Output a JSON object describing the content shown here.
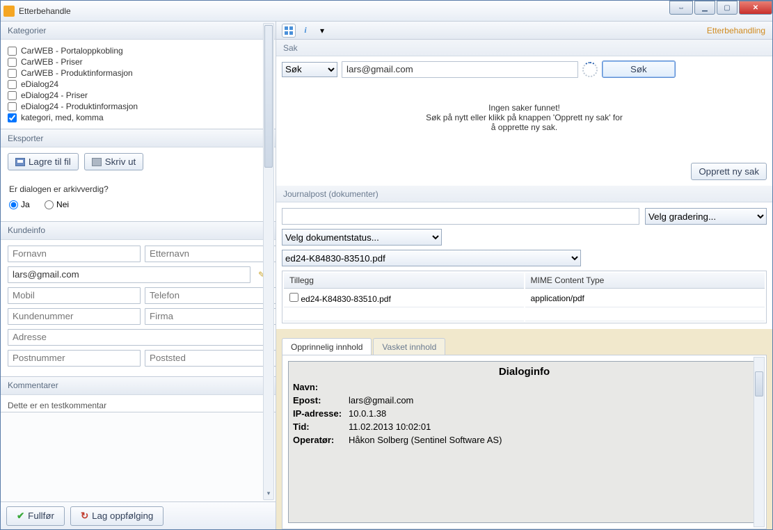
{
  "window": {
    "title": "Etterbehandle"
  },
  "right_header": {
    "title": "Etterbehandling"
  },
  "left": {
    "kategorier_title": "Kategorier",
    "kategori_items": [
      {
        "label": "CarWEB - Portaloppkobling",
        "checked": false
      },
      {
        "label": "CarWEB - Priser",
        "checked": false
      },
      {
        "label": "CarWEB - Produktinformasjon",
        "checked": false
      },
      {
        "label": "eDialog24",
        "checked": false
      },
      {
        "label": "eDialog24 - Priser",
        "checked": false
      },
      {
        "label": "eDialog24 - Produktinformasjon",
        "checked": false
      },
      {
        "label": "kategori, med, komma",
        "checked": true
      }
    ],
    "eksporter_title": "Eksporter",
    "lagre_btn": "Lagre til fil",
    "skrivut_btn": "Skriv ut",
    "arkiv_q": "Er dialogen er arkivverdig?",
    "arkiv_ja": "Ja",
    "arkiv_nei": "Nei",
    "kundeinfo_title": "Kundeinfo",
    "kunde": {
      "fornavn_ph": "Fornavn",
      "etternavn_ph": "Etternavn",
      "email": "lars@gmail.com",
      "mobil_ph": "Mobil",
      "telefon_ph": "Telefon",
      "kundenr_ph": "Kundenummer",
      "firma_ph": "Firma",
      "adresse_ph": "Adresse",
      "postnr_ph": "Postnummer",
      "poststed_ph": "Poststed"
    },
    "kommentarer_title": "Kommentarer",
    "kommentar_text": "Dette er en testkommentar"
  },
  "footer": {
    "fullfor": "Fullfør",
    "lagopp": "Lag oppfølging"
  },
  "sak": {
    "section_title": "Sak",
    "dropdown": "Søk",
    "search_value": "lars@gmail.com",
    "sok_btn": "Søk",
    "msg_l1": "Ingen saker funnet!",
    "msg_l2": "Søk på nytt  eller klikk på knappen 'Opprett ny sak' for",
    "msg_l3": "å opprette ny sak.",
    "opprett_btn": "Opprett ny sak"
  },
  "journal": {
    "section_title": "Journalpost (dokumenter)",
    "gradering": "Velg gradering...",
    "dokstatus": "Velg dokumentstatus...",
    "file_sel": "ed24-K84830-83510.pdf",
    "col_tillegg": "Tillegg",
    "col_mime": "MIME Content Type",
    "row_file": "ed24-K84830-83510.pdf",
    "row_mime": "application/pdf"
  },
  "tabs": {
    "t1": "Opprinnelig innhold",
    "t2": "Vasket innhold"
  },
  "dialoginfo": {
    "title": "Dialoginfo",
    "navn_k": "Navn:",
    "navn_v": "",
    "epost_k": "Epost:",
    "epost_v": "lars@gmail.com",
    "ip_k": "IP-adresse:",
    "ip_v": "10.0.1.38",
    "tid_k": "Tid:",
    "tid_v": "11.02.2013 10:02:01",
    "op_k": "Operatør:",
    "op_v": "Håkon Solberg (Sentinel Software AS)"
  }
}
